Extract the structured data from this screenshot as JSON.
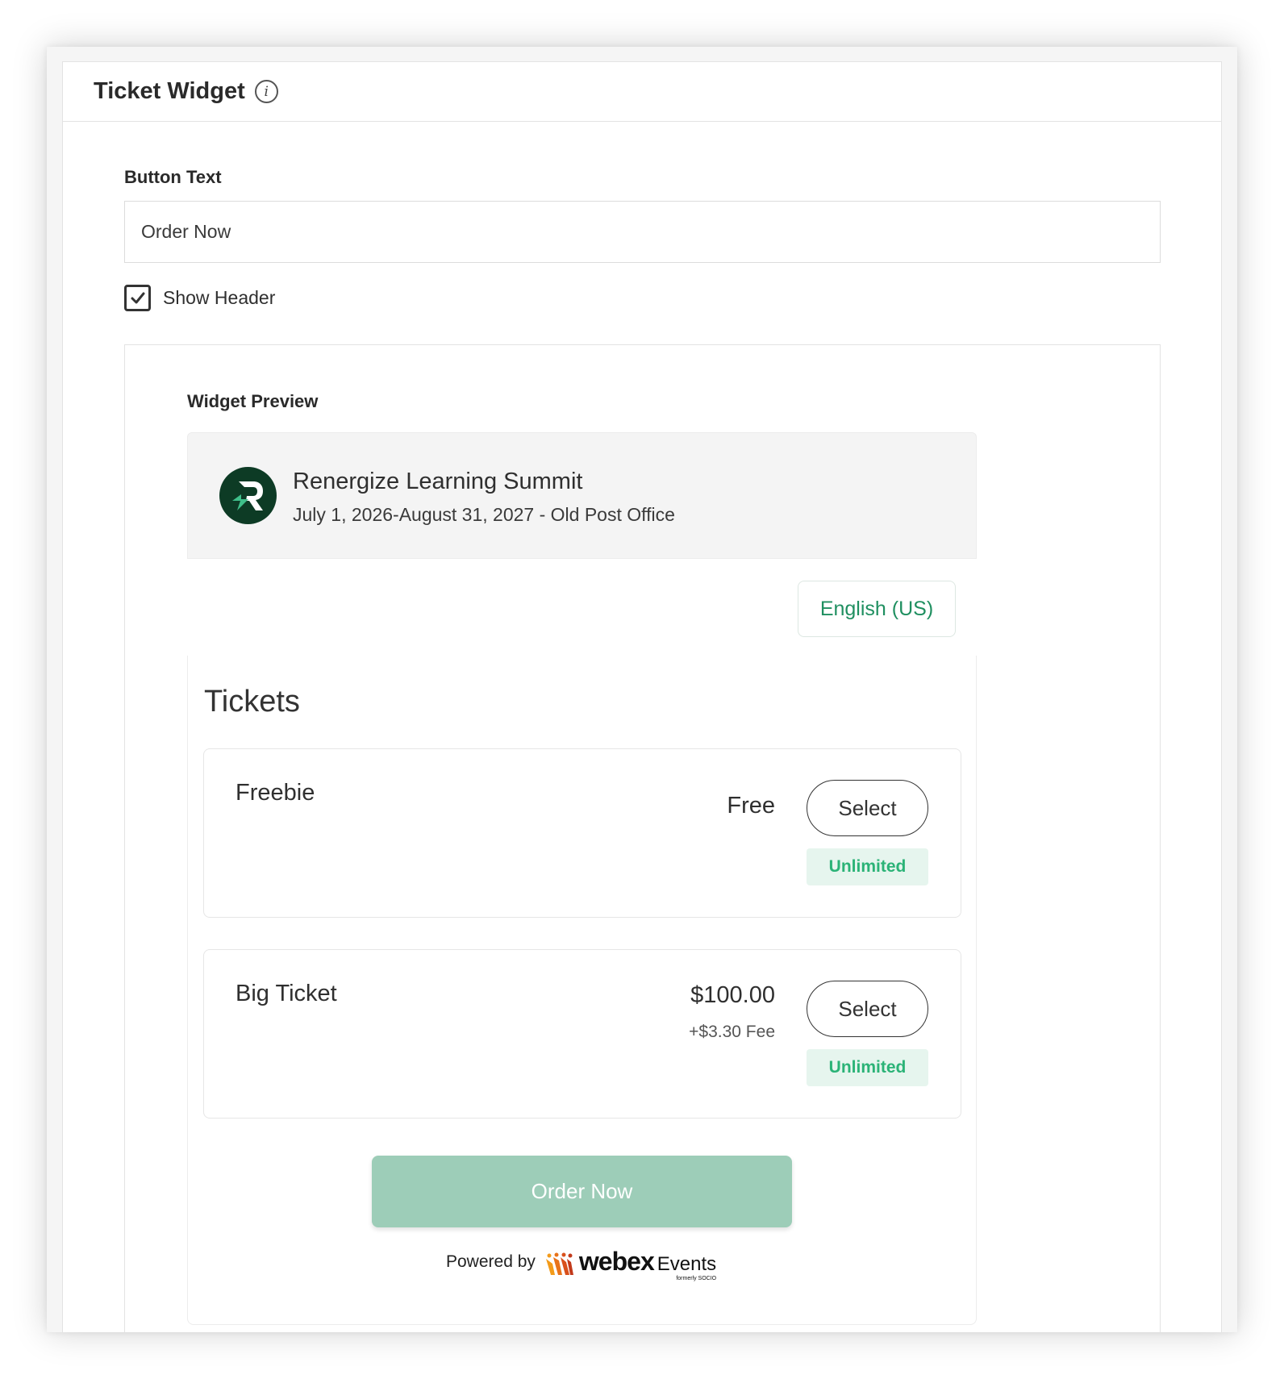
{
  "panel": {
    "title": "Ticket Widget"
  },
  "form": {
    "button_text_label": "Button Text",
    "button_text_value": "Order Now",
    "show_header_label": "Show Header",
    "show_header_checked": true
  },
  "preview": {
    "label": "Widget Preview",
    "event": {
      "name": "Renergize Learning Summit",
      "details": "July 1, 2026-August 31, 2027 - Old Post Office",
      "logo_color": "#0d3b25"
    },
    "language": "English (US)",
    "tickets_title": "Tickets",
    "tickets": [
      {
        "name": "Freebie",
        "price": "Free",
        "fee": "",
        "select_label": "Select",
        "availability": "Unlimited"
      },
      {
        "name": "Big Ticket",
        "price": "$100.00",
        "fee": "+$3.30 Fee",
        "select_label": "Select",
        "availability": "Unlimited"
      }
    ],
    "order_button": "Order Now",
    "powered_by": "Powered by",
    "brand_name": "webex",
    "brand_suffix": "Events",
    "brand_formerly": "formerly SOCIO"
  },
  "colors": {
    "accent_green": "#1f8f60",
    "badge_green": "#2bb377",
    "order_button_bg": "#9dcdb8"
  }
}
